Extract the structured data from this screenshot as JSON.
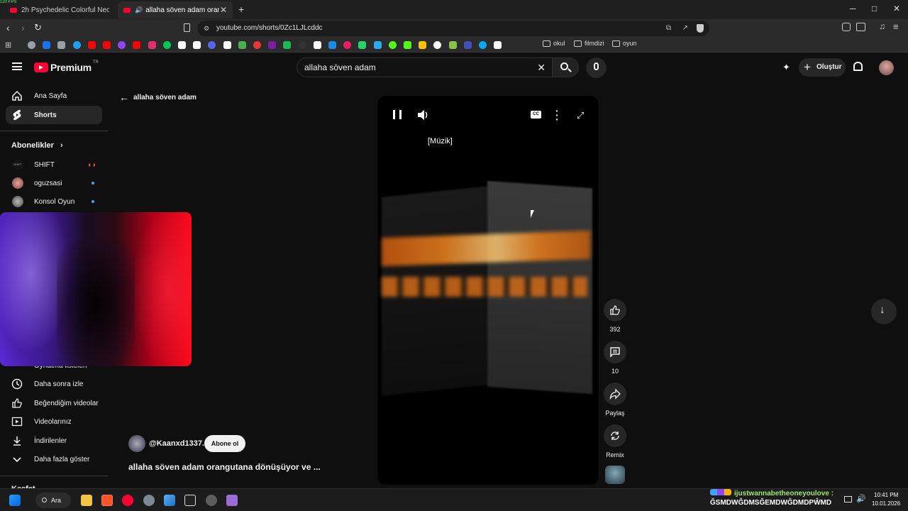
{
  "fps_overlay": "120 FPS",
  "tabs": [
    {
      "title": "2h Psychedelic Colorful Neon Backgr",
      "active": false
    },
    {
      "title": "allaha söven adam orangutan",
      "active": true
    }
  ],
  "window_controls": {
    "minimize": "─",
    "maximize": "□",
    "close": "✕"
  },
  "address": {
    "url": "youtube.com/shorts/0Zc1LJLcddc"
  },
  "bookmarks": {
    "folders": [
      "okul",
      "filmdizi",
      "oyun"
    ],
    "colors": [
      "#9aa0a6",
      "#1a73e8",
      "#9aa0a6",
      "#1da1f2",
      "#ff0000",
      "#ff0000",
      "#9146ff",
      "#ff0000",
      "#e1306c",
      "#00c853",
      "#ffffff",
      "#ffffff",
      "#5865f2",
      "#ffffff",
      "#4caf50",
      "#e53935",
      "#7b1fa2",
      "#1db954",
      "#333333",
      "#ffffff",
      "#1e88e5",
      "#e91e63",
      "#25d366",
      "#2aabee",
      "#53fc18",
      "#53fc18",
      "#ffc107",
      "#ffffff",
      "#8bc34a",
      "#3f51b5",
      "#03a9f4",
      "#ffffff"
    ]
  },
  "youtube": {
    "logo_text": "Premium",
    "logo_badge": "TR",
    "search_value": "allaha söven adam",
    "create_label": "Oluştur"
  },
  "sidebar": {
    "items": [
      {
        "label": "Ana Sayfa",
        "icon": "home-icon"
      },
      {
        "label": "Shorts",
        "icon": "shorts-icon",
        "selected": true
      }
    ],
    "subscriptions_heading": "Abonelikler",
    "subscriptions": [
      {
        "label": "SHIFT",
        "avatar_text": "SHIFT",
        "badge": "live"
      },
      {
        "label": "oguzsasi",
        "badge": "dot"
      },
      {
        "label": "Konsol Oyun",
        "badge": "dot"
      }
    ],
    "you_items": [
      {
        "label": "Oynatma listeleri",
        "icon": "playlist-icon"
      },
      {
        "label": "Daha sonra izle",
        "icon": "clock-icon"
      },
      {
        "label": "Beğendiğim videolar",
        "icon": "thumbs-up-icon"
      },
      {
        "label": "Videolarınız",
        "icon": "video-icon"
      },
      {
        "label": "İndirilenler",
        "icon": "download-icon"
      },
      {
        "label": "Daha fazla göster",
        "icon": "chevron-down-icon"
      }
    ],
    "next_heading": "Keşfet"
  },
  "shorts": {
    "back_query": "allaha söven adam",
    "caption": "[Müzik]",
    "channel": "@Kaanxd1337.",
    "subscribe_label": "Abone ol",
    "title": "allaha söven adam orangutana dönüşüyor ve ...",
    "like_count": "392",
    "comment_count": "10",
    "share_label": "Paylaş",
    "remix_label": "Remix"
  },
  "taskbar": {
    "search_label": "Ara",
    "chat_line1": "ijustwannabetheoneyoulove :",
    "chat_line2": "ĞSMDWĞDMSĞEMDWĞDMDPŴMD",
    "time": "10:41 PM",
    "date": "10.01.2026"
  }
}
